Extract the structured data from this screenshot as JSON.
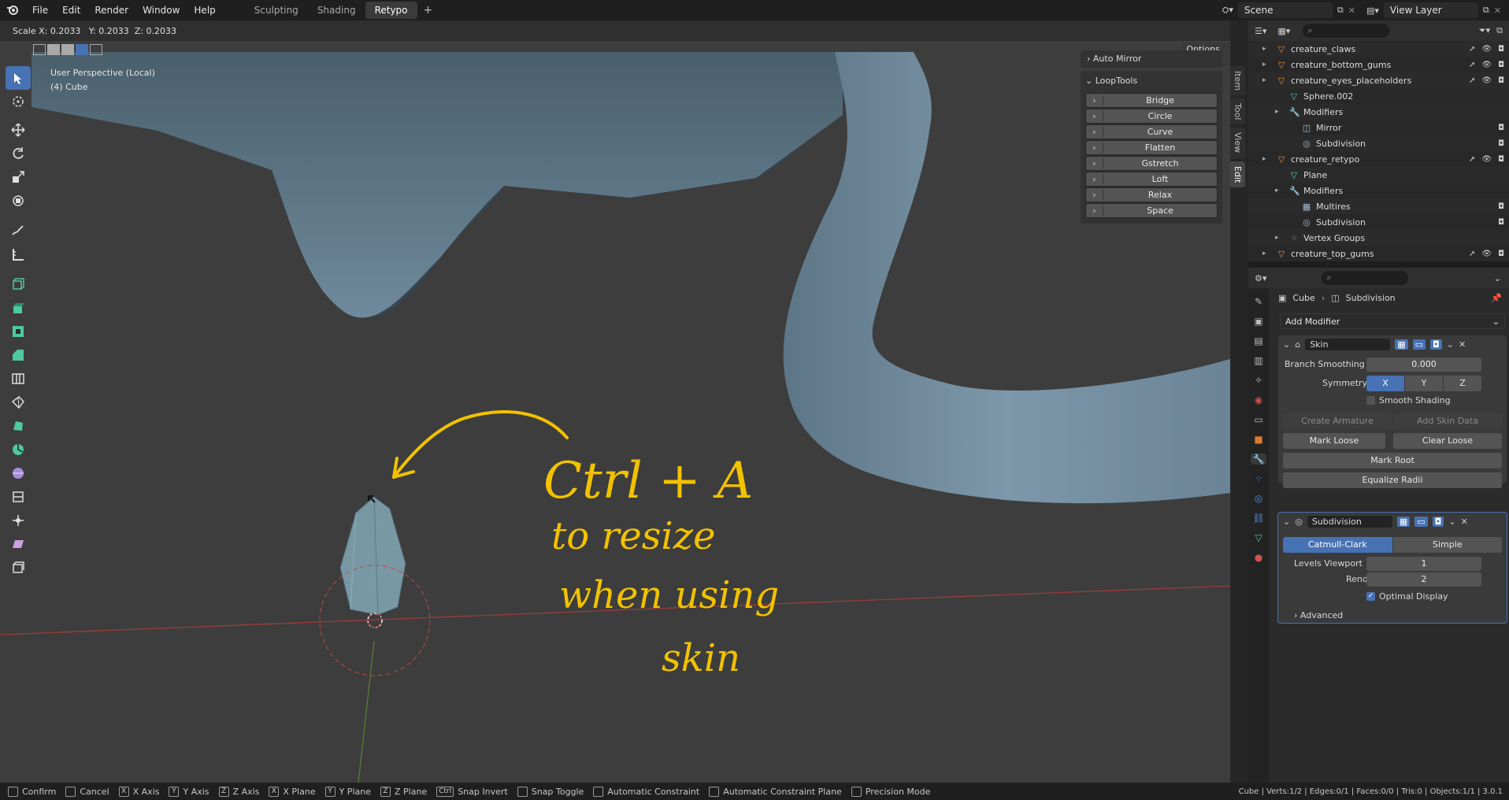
{
  "menu": [
    "File",
    "Edit",
    "Render",
    "Window",
    "Help"
  ],
  "workspaces": [
    "Sculpting",
    "Shading",
    "Retypo"
  ],
  "active_workspace": "Retypo",
  "scene_name": "Scene",
  "view_layer": "View Layer",
  "scale_readout": "Scale X: 0.2033   Y: 0.2033  Z: 0.2033",
  "viewport": {
    "perspective": "User Perspective (Local)",
    "object": "(4) Cube",
    "options_label": "Options",
    "axes": [
      "X",
      "Y",
      "Z"
    ]
  },
  "npanel": {
    "tabs": [
      "Item",
      "Tool",
      "View",
      "Edit"
    ],
    "auto_mirror": "Auto Mirror",
    "looptools": "LoopTools",
    "buttons": [
      "Bridge",
      "Circle",
      "Curve",
      "Flatten",
      "Gstretch",
      "Loft",
      "Relax",
      "Space"
    ]
  },
  "annotations": {
    "line1": "Ctrl + A",
    "line2": "to resize",
    "line3": "when using",
    "line4": "skin",
    "color": "#f2c200"
  },
  "outliner": {
    "rows": [
      {
        "label": "creature_claws",
        "indent": 0,
        "icon": "mesh-icon"
      },
      {
        "label": "creature_bottom_gums",
        "indent": 0,
        "icon": "mesh-icon"
      },
      {
        "label": "creature_eyes_placeholders",
        "indent": 0,
        "icon": "mesh-icon"
      },
      {
        "label": "Sphere.002",
        "indent": 1,
        "icon": "mesh-data-icon"
      },
      {
        "label": "Modifiers",
        "indent": 1,
        "icon": "wrench-icon"
      },
      {
        "label": "Mirror",
        "indent": 2,
        "icon": "mirror-icon"
      },
      {
        "label": "Subdivision",
        "indent": 2,
        "icon": "subdivision-icon"
      },
      {
        "label": "creature_retypo",
        "indent": 0,
        "icon": "mesh-icon"
      },
      {
        "label": "Plane",
        "indent": 1,
        "icon": "mesh-data-icon"
      },
      {
        "label": "Modifiers",
        "indent": 1,
        "icon": "wrench-icon"
      },
      {
        "label": "Multires",
        "indent": 2,
        "icon": "multires-icon"
      },
      {
        "label": "Subdivision",
        "indent": 2,
        "icon": "subdivision-icon"
      },
      {
        "label": "Vertex Groups",
        "indent": 1,
        "icon": "vertex-groups-icon"
      },
      {
        "label": "creature_top_gums",
        "indent": 0,
        "icon": "mesh-icon"
      }
    ]
  },
  "properties": {
    "breadcrumb_object": "Cube",
    "breadcrumb_modifier": "Subdivision",
    "add_modifier": "Add Modifier",
    "skin": {
      "name": "Skin",
      "branch_smoothing_label": "Branch Smoothing",
      "branch_smoothing_value": "0.000",
      "symmetry_label": "Symmetry",
      "symmetry": [
        "X",
        "Y",
        "Z"
      ],
      "smooth_shading": "Smooth Shading",
      "create_armature": "Create Armature",
      "add_skin_data": "Add Skin Data",
      "mark_loose": "Mark Loose",
      "clear_loose": "Clear Loose",
      "mark_root": "Mark Root",
      "equalize_radii": "Equalize Radii"
    },
    "subdivision": {
      "name": "Subdivision",
      "catmull": "Catmull-Clark",
      "simple": "Simple",
      "levels_viewport_label": "Levels Viewport",
      "levels_viewport_value": "1",
      "render_label": "Render",
      "render_value": "2",
      "optimal_display": "Optimal Display",
      "advanced": "Advanced"
    }
  },
  "statusbar": {
    "items": [
      "Confirm",
      "Cancel",
      "X Axis",
      "Y Axis",
      "Z Axis",
      "X Plane",
      "Y Plane",
      "Z Plane",
      "Snap Invert",
      "Snap Toggle",
      "Automatic Constraint",
      "Automatic Constraint Plane",
      "Precision Mode"
    ],
    "keys": [
      "",
      "",
      "X",
      "Y",
      "Z",
      "X",
      "Y",
      "Z",
      "Ctrl",
      "",
      "",
      "",
      ""
    ],
    "stats": "Cube | Verts:1/2 | Edges:0/1 | Faces:0/0 | Tris:0 | Objects:1/1 | 3.0.1"
  }
}
